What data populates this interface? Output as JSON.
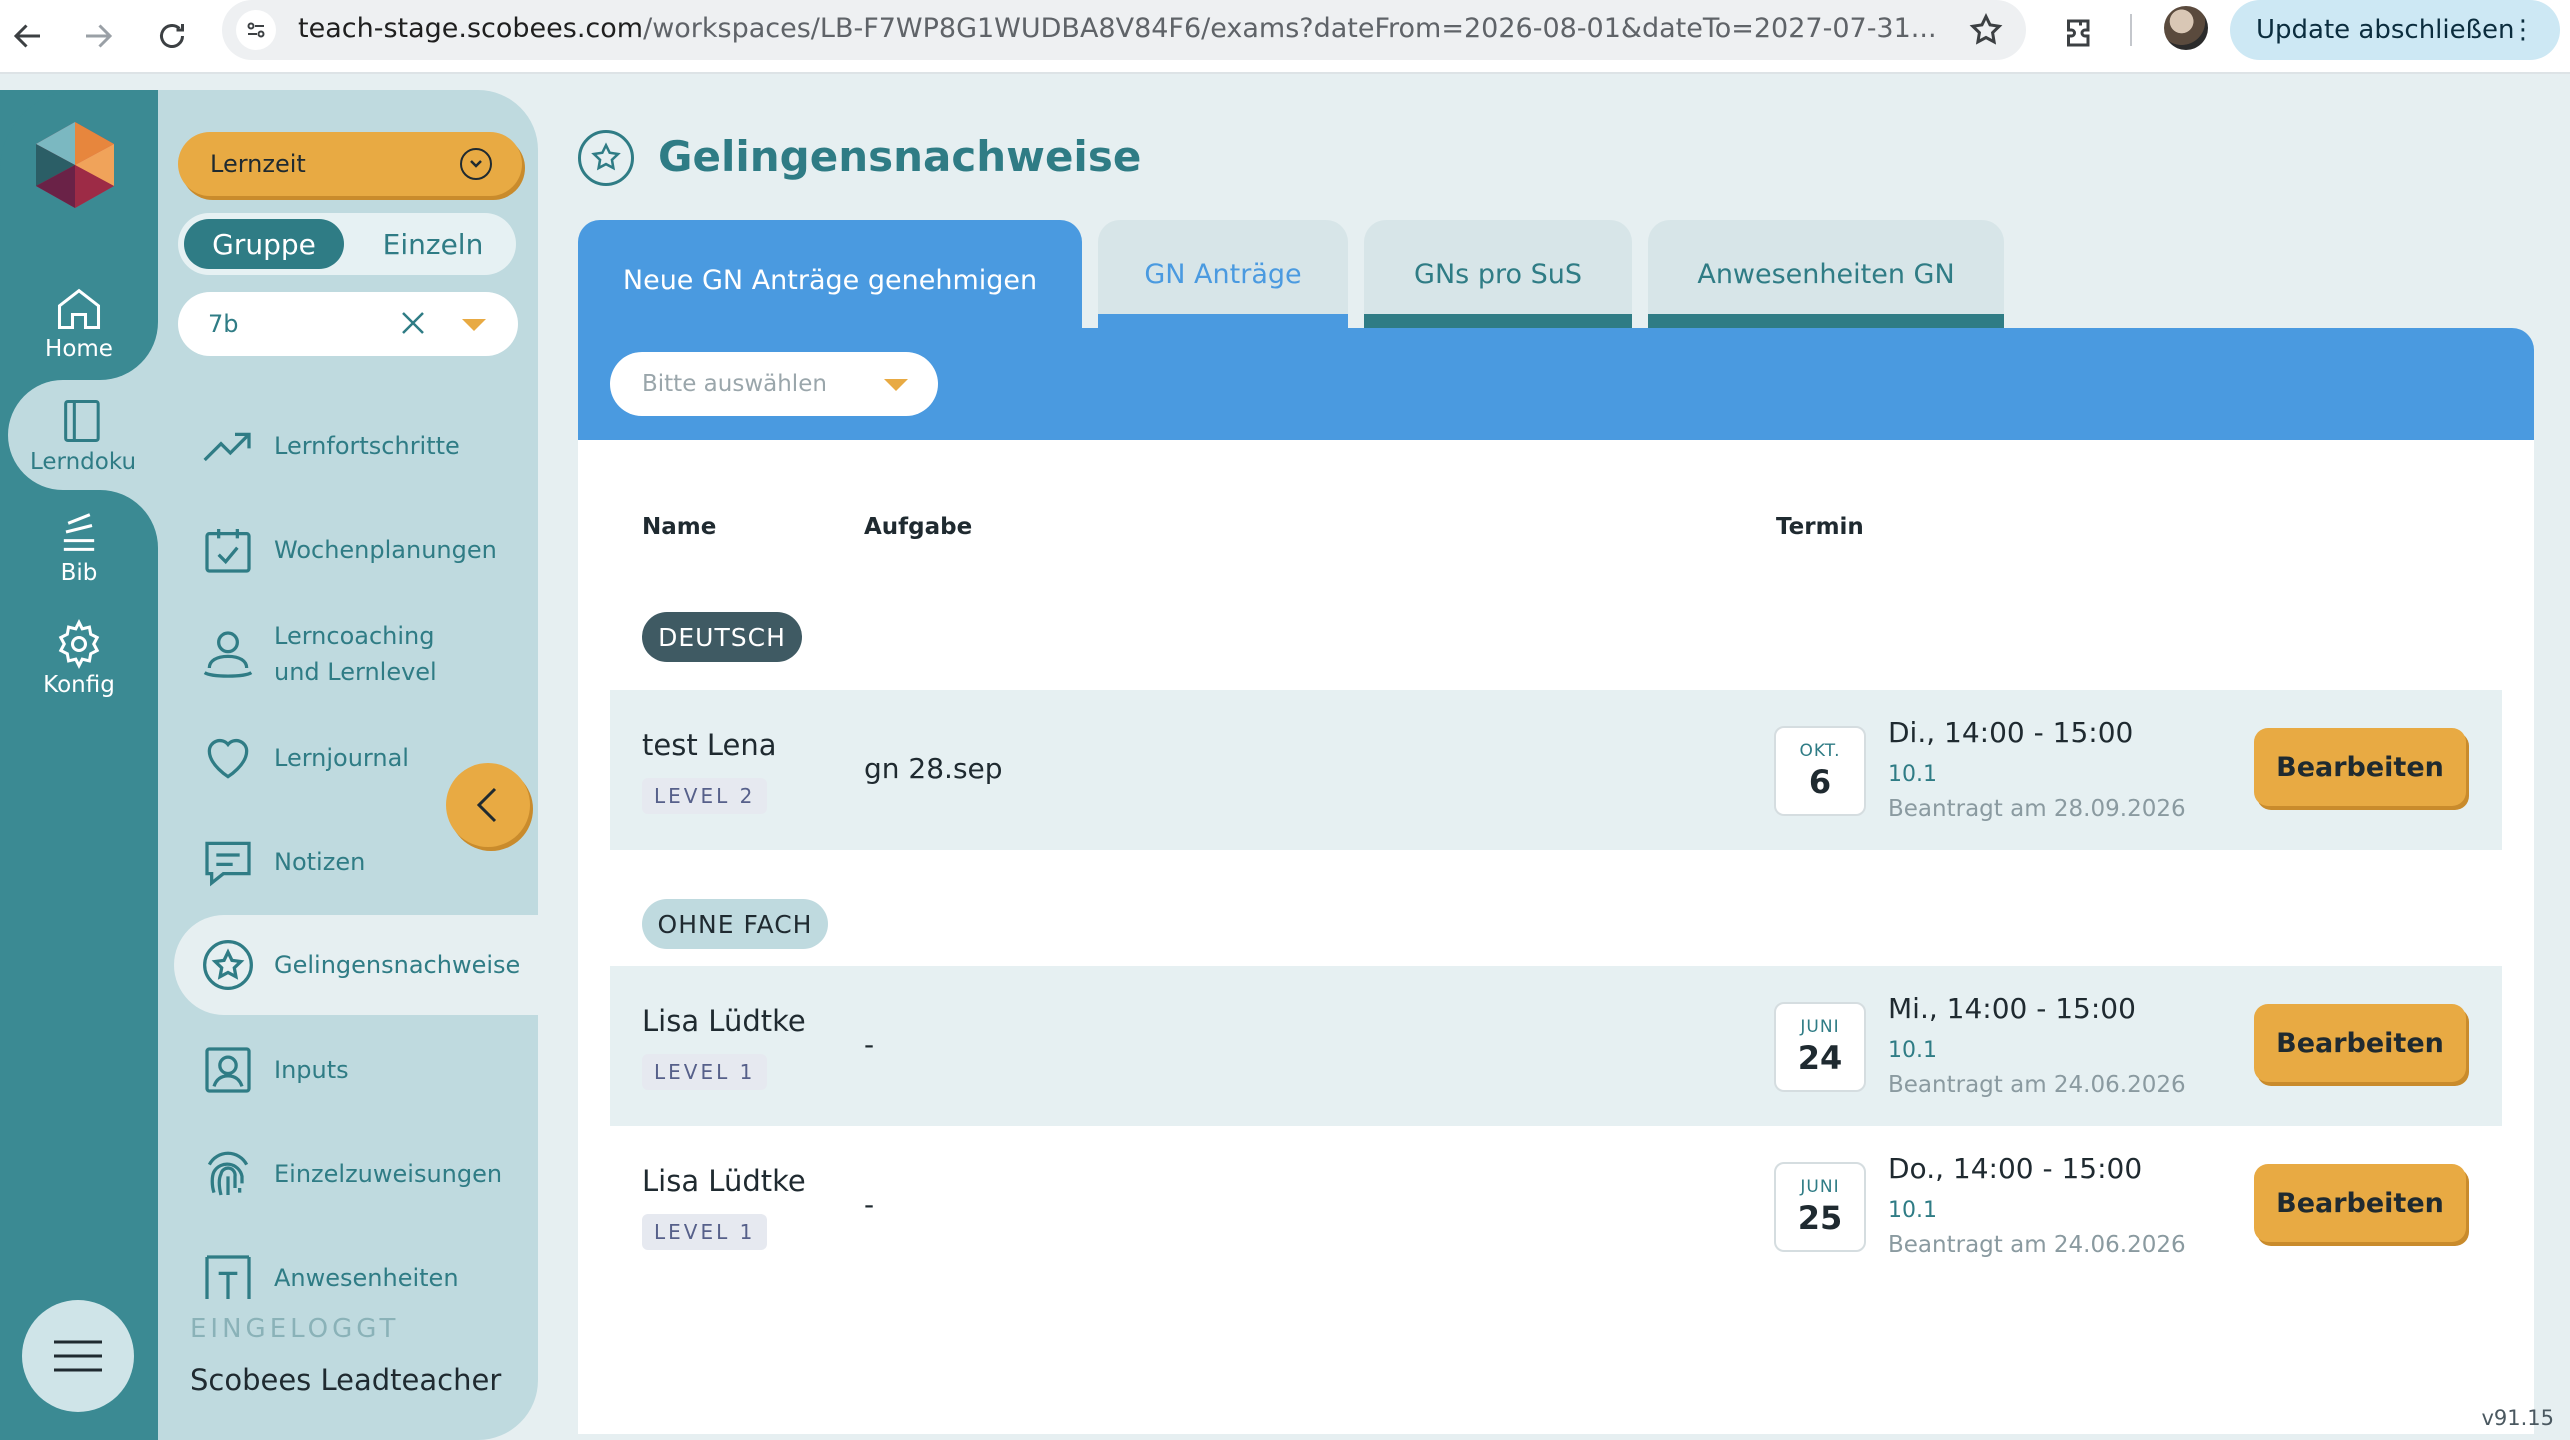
{
  "browser": {
    "url_host": "teach-stage.scobees.com",
    "url_path": "/workspaces/LB-F7WP8G1WUDBA8V84F6/exams?dateFrom=2026-08-01&dateTo=2027-07-31...",
    "update_label": "Update abschließen",
    "icons": [
      "back-arrow-icon",
      "forward-arrow-icon",
      "reload-icon",
      "site-settings-icon",
      "star-icon",
      "extensions-icon",
      "kebab-icon"
    ]
  },
  "rail": {
    "items": [
      {
        "label": "Home",
        "icon": "home-icon"
      },
      {
        "label": "Lerndoku",
        "icon": "book-icon"
      },
      {
        "label": "Bib",
        "icon": "stack-icon"
      },
      {
        "label": "Konfig",
        "icon": "gear-icon"
      }
    ]
  },
  "sidebar": {
    "lernzeit_label": "Lernzeit",
    "toggle": {
      "active": "Gruppe",
      "inactive": "Einzeln"
    },
    "group_value": "7b",
    "items": [
      {
        "label": "Lernfortschritte",
        "icon": "trend-icon"
      },
      {
        "label": "Wochenplanungen",
        "icon": "calendar-icon"
      },
      {
        "label": "Lerncoaching\nund Lernlevel",
        "line1": "Lerncoaching",
        "line2": "und Lernlevel",
        "icon": "person-icon"
      },
      {
        "label": "Lernjournal",
        "icon": "heart-icon"
      },
      {
        "label": "Notizen",
        "icon": "chat-icon"
      },
      {
        "label": "Gelingensnachweise",
        "icon": "star-circle-icon"
      },
      {
        "label": "Inputs",
        "icon": "user-box-icon"
      },
      {
        "label": "Einzelzuweisungen",
        "icon": "fingerprint-icon"
      },
      {
        "label": "Anwesenheiten",
        "icon": "attendance-icon"
      }
    ],
    "eingeloggt_label": "EINGELOGGT",
    "username": "Scobees Leadteacher"
  },
  "main": {
    "title": "Gelingensnachweise",
    "tabs": [
      {
        "label": "Neue GN Anträge genehmigen"
      },
      {
        "label": "GN Anträge"
      },
      {
        "label": "GNs pro SuS"
      },
      {
        "label": "Anwesenheiten GN"
      }
    ],
    "filter_placeholder": "Bitte auswählen",
    "columns": {
      "name": "Name",
      "task": "Aufgabe",
      "date": "Termin"
    },
    "groups": [
      {
        "label": "DEUTSCH",
        "rows": [
          {
            "name": "test Lena",
            "level": "LEVEL 2",
            "task": "gn 28.sep",
            "month": "OKT.",
            "day": "6",
            "time": "Di., 14:00 - 15:00",
            "room": "10.1",
            "requested": "Beantragt am 28.09.2026",
            "action": "Bearbeiten"
          }
        ]
      },
      {
        "label": "OHNE FACH",
        "rows": [
          {
            "name": "Lisa Lüdtke",
            "level": "LEVEL 1",
            "task": "-",
            "month": "JUNI",
            "day": "24",
            "time": "Mi., 14:00 - 15:00",
            "room": "10.1",
            "requested": "Beantragt am 24.06.2026",
            "action": "Bearbeiten"
          },
          {
            "name": "Lisa Lüdtke",
            "level": "LEVEL 1",
            "task": "-",
            "month": "JUNI",
            "day": "25",
            "time": "Do., 14:00 - 15:00",
            "room": "10.1",
            "requested": "Beantragt am 24.06.2026",
            "action": "Bearbeiten"
          }
        ]
      }
    ],
    "version": "v91.15"
  },
  "colors": {
    "teal": "#3b8a93",
    "accent_orange": "#e8aa43",
    "tab_blue": "#4a9ae0"
  }
}
